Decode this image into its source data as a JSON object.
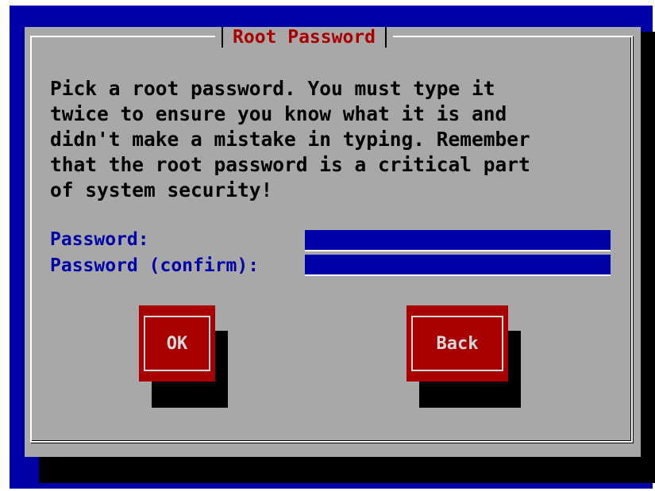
{
  "dialog": {
    "title": "Root Password",
    "message": "Pick a root password. You must type it\ntwice to ensure you know what it is and\ndidn't make a mistake in typing. Remember\nthat the root password is a critical part\nof system security!"
  },
  "fields": {
    "password": {
      "label": "Password:",
      "value": ""
    },
    "confirm": {
      "label": "Password (confirm):",
      "value": ""
    }
  },
  "buttons": {
    "ok_label": "OK",
    "back_label": "Back"
  },
  "colors": {
    "background": "#0000a8",
    "dialog": "#a8a8a8",
    "title": "#a80000",
    "label": "#0000a8",
    "button": "#a80000"
  }
}
